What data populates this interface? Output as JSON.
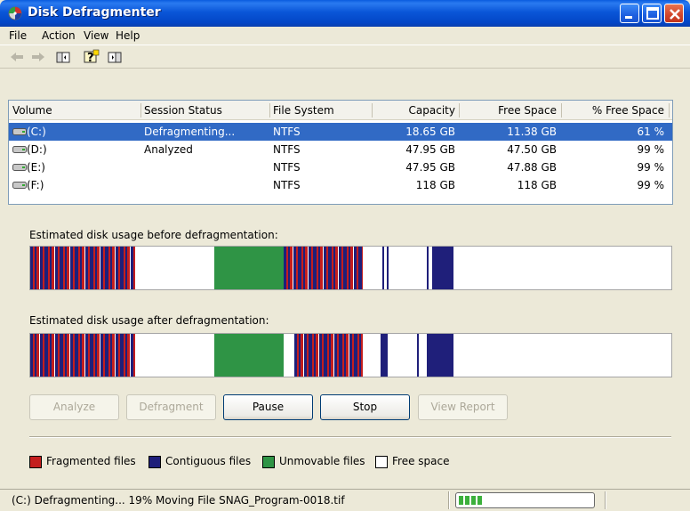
{
  "window": {
    "title": "Disk Defragmenter"
  },
  "menu": [
    "File",
    "Action",
    "View",
    "Help"
  ],
  "toolbar": {
    "icons": [
      "back-arrow-icon",
      "forward-arrow-icon",
      "show-hide-console-tree-icon",
      "help-icon",
      "show-hide-action-pane-icon"
    ]
  },
  "volumes": {
    "columns": [
      "Volume",
      "Session Status",
      "File System",
      "Capacity",
      "Free Space",
      "% Free Space"
    ],
    "rows": [
      {
        "volume": "(C:)",
        "status": "Defragmenting...",
        "fs": "NTFS",
        "capacity": "18.65 GB",
        "free": "11.38 GB",
        "pct": "61 %",
        "selected": true
      },
      {
        "volume": "(D:)",
        "status": "Analyzed",
        "fs": "NTFS",
        "capacity": "47.95 GB",
        "free": "47.50 GB",
        "pct": "99 %",
        "selected": false
      },
      {
        "volume": "(E:)",
        "status": "",
        "fs": "NTFS",
        "capacity": "47.95 GB",
        "free": "47.88 GB",
        "pct": "99 %",
        "selected": false
      },
      {
        "volume": "(F:)",
        "status": "",
        "fs": "NTFS",
        "capacity": "118 GB",
        "free": "118 GB",
        "pct": "99 %",
        "selected": false
      }
    ]
  },
  "usage": {
    "before_label": "Estimated disk usage before defragmentation:",
    "after_label": "Estimated disk usage after defragmentation:"
  },
  "buttons": {
    "analyze": "Analyze",
    "defragment": "Defragment",
    "pause": "Pause",
    "stop": "Stop",
    "view_report": "View Report"
  },
  "legend": {
    "fragmented": "Fragmented files",
    "contiguous": "Contiguous files",
    "unmovable": "Unmovable files",
    "free": "Free space"
  },
  "colors": {
    "fragmented": "#c41e1e",
    "contiguous": "#1f1f7a",
    "unmovable": "#2f9445",
    "free": "#ffffff",
    "selection": "#316ac5"
  },
  "status": {
    "text": "(C:) Defragmenting... 19% Moving File SNAG_Program-0018.tif",
    "progress": 0.19
  }
}
